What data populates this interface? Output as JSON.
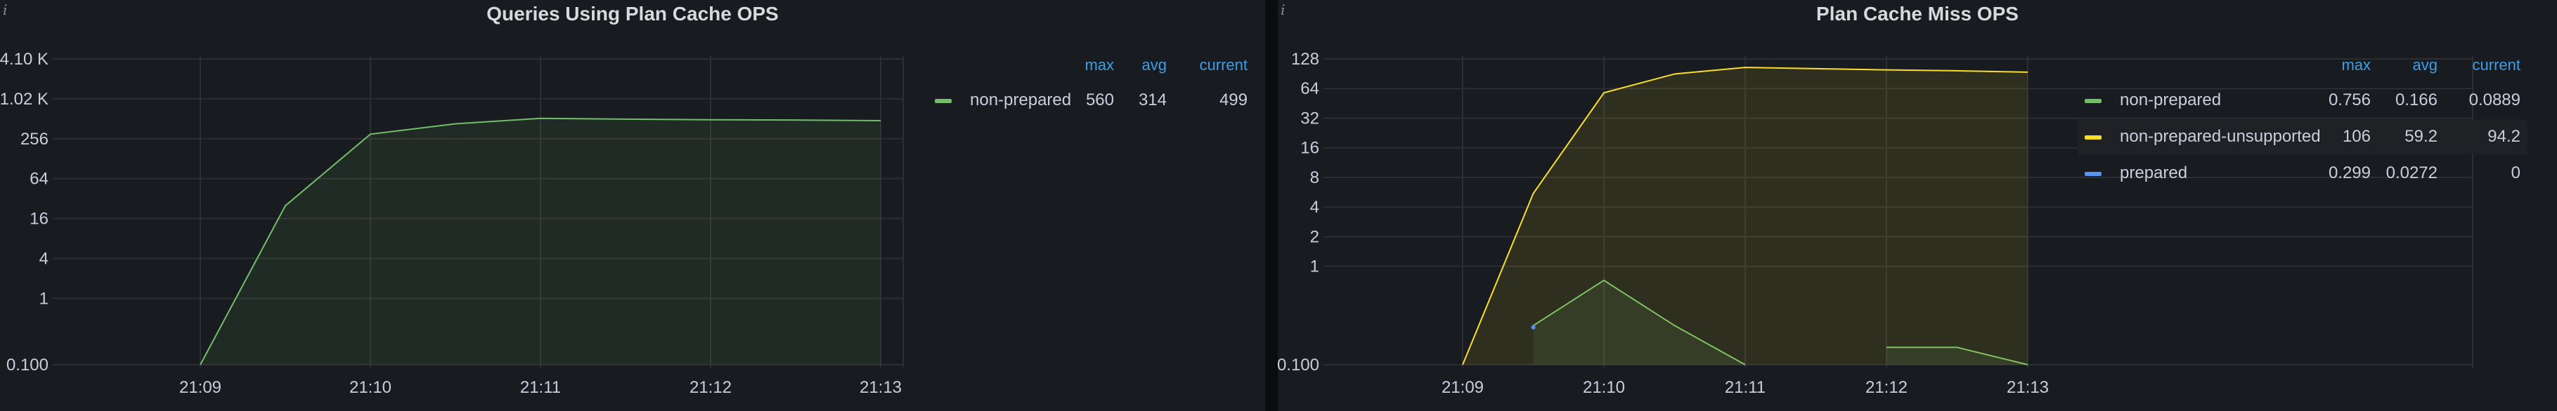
{
  "panels": [
    {
      "title": "Queries Using Plan Cache OPS",
      "info_icon": "i",
      "legend_headers": [
        "max",
        "avg",
        "current"
      ],
      "legend_rows": [
        {
          "name": "non-prepared",
          "color": "#73bf69",
          "max": "560",
          "avg": "314",
          "current": "499"
        }
      ]
    },
    {
      "title": "Plan Cache Miss OPS",
      "info_icon": "i",
      "legend_headers": [
        "max",
        "avg",
        "current"
      ],
      "legend_rows": [
        {
          "name": "non-prepared",
          "color": "#73bf69",
          "max": "0.756",
          "avg": "0.166",
          "current": "0.0889"
        },
        {
          "name": "non-prepared-unsupported",
          "color": "#fade2a",
          "max": "106",
          "avg": "59.2",
          "current": "94.2"
        },
        {
          "name": "prepared",
          "color": "#5794f2",
          "max": "0.299",
          "avg": "0.0272",
          "current": "0"
        }
      ]
    }
  ],
  "chart_data": [
    {
      "type": "area",
      "title": "Queries Using Plan Cache OPS",
      "y_scale": "log2",
      "ytick_labels": [
        "4.10 K",
        "1.02 K",
        "256",
        "64",
        "16",
        "4",
        "1",
        "0.100"
      ],
      "ytick_values": [
        4096,
        1024,
        256,
        64,
        16,
        4,
        1,
        0.1
      ],
      "xtick_labels": [
        "21:09",
        "21:10",
        "21:11",
        "21:12",
        "21:13"
      ],
      "x": [
        "21:09:00",
        "21:09:30",
        "21:10:00",
        "21:10:30",
        "21:11:00",
        "21:11:30",
        "21:12:00",
        "21:12:30",
        "21:13:00"
      ],
      "series": [
        {
          "name": "non-prepared",
          "color": "#73bf69",
          "values": [
            0.1,
            25,
            300,
            430,
            520,
            505,
            495,
            490,
            480
          ]
        }
      ]
    },
    {
      "type": "area",
      "title": "Plan Cache Miss OPS",
      "y_scale": "log2",
      "ytick_labels": [
        "128",
        "64",
        "32",
        "16",
        "8",
        "4",
        "2",
        "1",
        "0.100"
      ],
      "ytick_values": [
        128,
        64,
        32,
        16,
        8,
        4,
        2,
        1,
        0.1
      ],
      "xtick_labels": [
        "21:09",
        "21:10",
        "21:11",
        "21:12",
        "21:13"
      ],
      "x": [
        "21:09:00",
        "21:09:30",
        "21:10:00",
        "21:10:30",
        "21:11:00",
        "21:11:30",
        "21:12:00",
        "21:12:30",
        "21:13:00"
      ],
      "series": [
        {
          "name": "non-prepared",
          "color": "#73bf69",
          "values": [
            null,
            0.25,
            0.72,
            0.25,
            0.1,
            null,
            0.15,
            0.15,
            0.1
          ]
        },
        {
          "name": "non-prepared-unsupported",
          "color": "#fade2a",
          "values": [
            0.1,
            5.5,
            58,
            90,
            105,
            102,
            99,
            97,
            94
          ]
        },
        {
          "name": "prepared",
          "color": "#5794f2",
          "values": [
            null,
            0.24,
            null,
            null,
            null,
            null,
            null,
            null,
            null
          ]
        }
      ]
    }
  ]
}
